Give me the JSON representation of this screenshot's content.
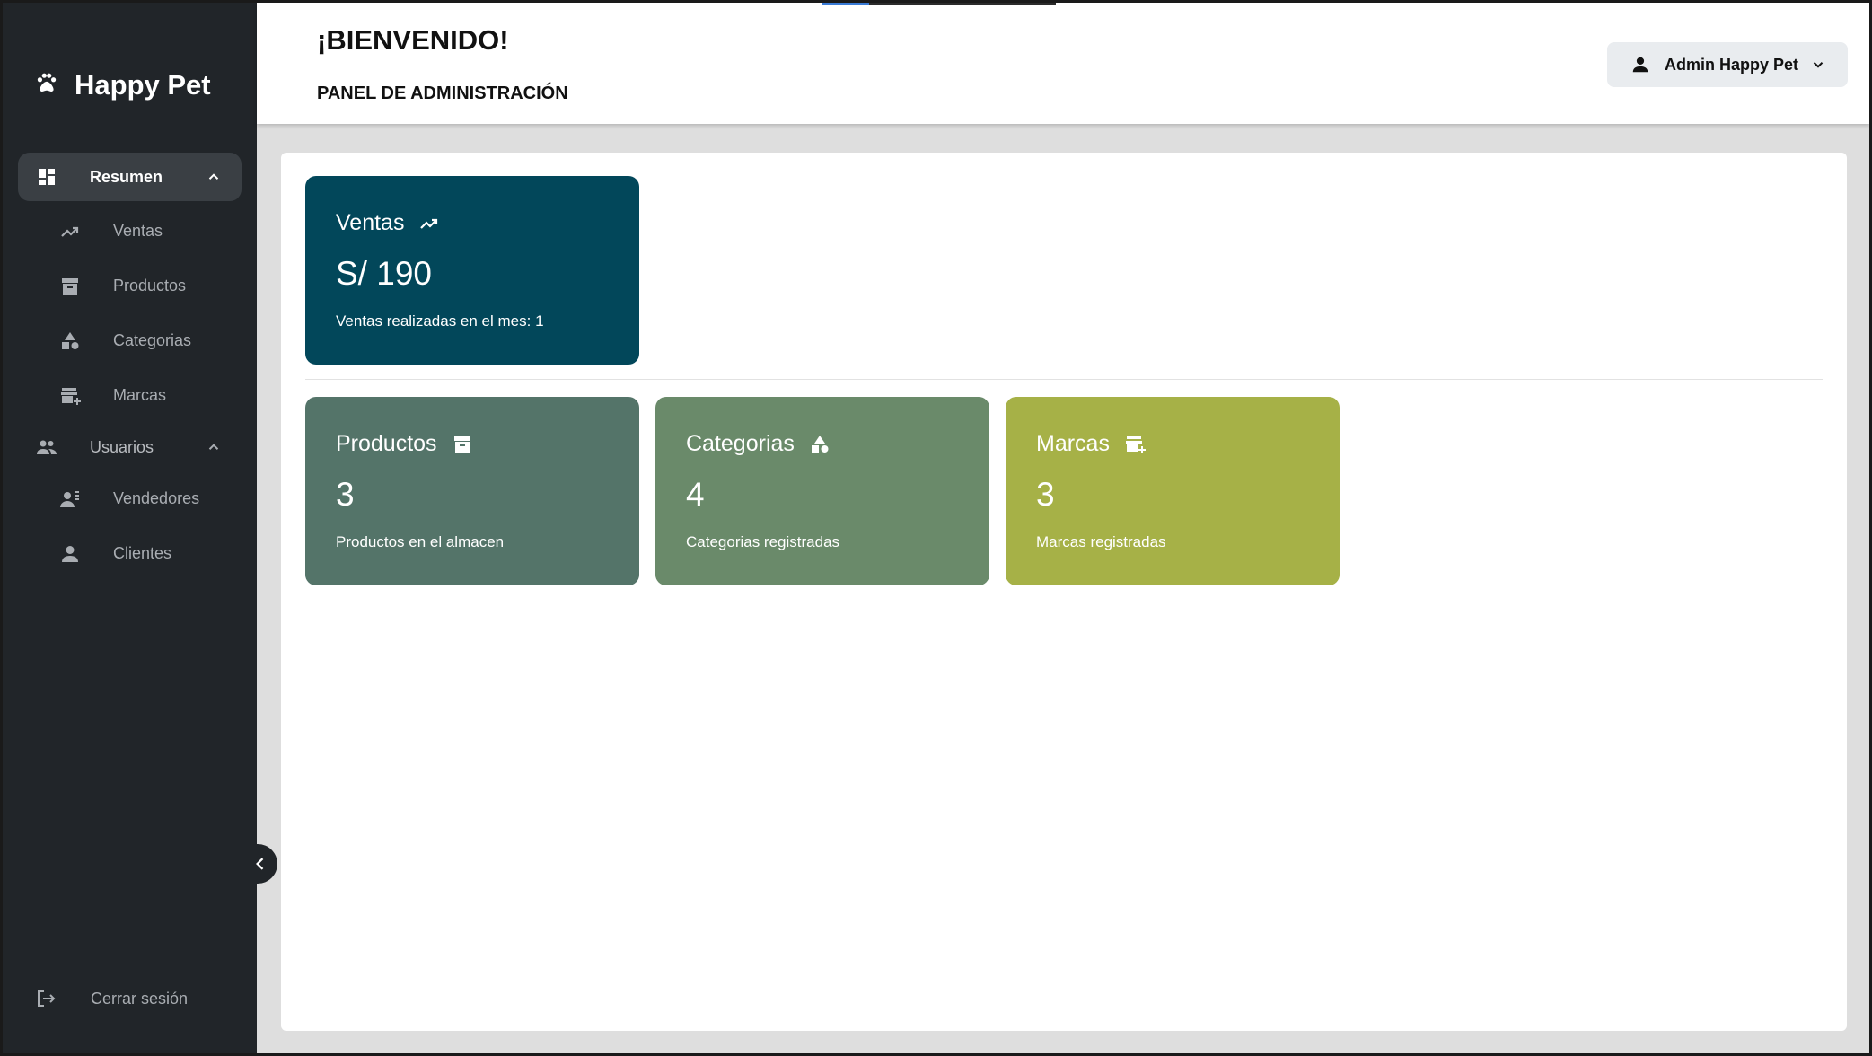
{
  "brand": {
    "name": "Happy Pet",
    "icon": "paw-icon"
  },
  "sidebar": {
    "groups": [
      {
        "label": "Resumen",
        "icon": "dashboard-icon",
        "expanded": true,
        "active": true,
        "items": [
          {
            "label": "Ventas",
            "icon": "trending-up-icon"
          },
          {
            "label": "Productos",
            "icon": "archive-box-icon"
          },
          {
            "label": "Categorias",
            "icon": "shapes-icon"
          },
          {
            "label": "Marcas",
            "icon": "store-add-icon"
          }
        ]
      },
      {
        "label": "Usuarios",
        "icon": "users-icon",
        "expanded": true,
        "active": false,
        "items": [
          {
            "label": "Vendedores",
            "icon": "seller-icon"
          },
          {
            "label": "Clientes",
            "icon": "person-icon"
          }
        ]
      }
    ],
    "logout_label": "Cerrar sesión"
  },
  "header": {
    "title": "¡BIENVENIDO!",
    "subtitle": "PANEL DE ADMINISTRACIÓN",
    "user_label": "Admin Happy Pet"
  },
  "cards": {
    "ventas": {
      "title": "Ventas",
      "value": "S/ 190",
      "desc": "Ventas realizadas en el mes: 1",
      "color": "#02475a"
    },
    "productos": {
      "title": "Productos",
      "value": "3",
      "desc": "Productos en el almacen",
      "color": "#547469"
    },
    "categorias": {
      "title": "Categorias",
      "value": "4",
      "desc": "Categorias registradas",
      "color": "#6a8a6a"
    },
    "marcas": {
      "title": "Marcas",
      "value": "3",
      "desc": "Marcas registradas",
      "color": "#a6b147"
    }
  },
  "colors": {
    "sidebar_bg": "#212529",
    "content_bg": "#dedede"
  }
}
